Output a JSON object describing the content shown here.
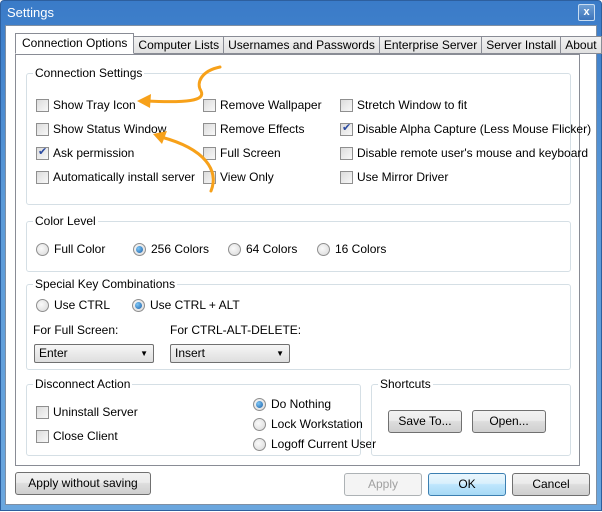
{
  "window": {
    "title": "Settings",
    "close_icon": "close-icon"
  },
  "tabs": [
    {
      "label": "Connection Options",
      "active": true
    },
    {
      "label": "Computer Lists",
      "active": false
    },
    {
      "label": "Usernames and Passwords",
      "active": false
    },
    {
      "label": "Enterprise Server",
      "active": false
    },
    {
      "label": "Server Install",
      "active": false
    },
    {
      "label": "About",
      "active": false
    }
  ],
  "connection_settings": {
    "label": "Connection Settings",
    "options": [
      {
        "label": "Show Tray Icon",
        "checked": false
      },
      {
        "label": "Show Status Window",
        "checked": false
      },
      {
        "label": "Ask permission",
        "checked": true
      },
      {
        "label": "Automatically install server",
        "checked": false
      },
      {
        "label": "Remove Wallpaper",
        "checked": false
      },
      {
        "label": "Remove Effects",
        "checked": false
      },
      {
        "label": "Full Screen",
        "checked": false
      },
      {
        "label": "View Only",
        "checked": false
      },
      {
        "label": "Stretch Window to fit",
        "checked": false
      },
      {
        "label": "Disable Alpha Capture (Less Mouse Flicker)",
        "checked": true
      },
      {
        "label": "Disable remote user's mouse and keyboard",
        "checked": false
      },
      {
        "label": "Use Mirror Driver",
        "checked": false
      }
    ]
  },
  "color_level": {
    "label": "Color Level",
    "options": [
      "Full Color",
      "256 Colors",
      "64 Colors",
      "16 Colors"
    ],
    "selected": "256 Colors"
  },
  "special_keys": {
    "label": "Special Key Combinations",
    "options": [
      "Use CTRL",
      "Use CTRL + ALT"
    ],
    "selected": "Use CTRL + ALT",
    "full_screen_label": "For Full Screen:",
    "full_screen_value": "Enter",
    "cad_label": "For CTRL-ALT-DELETE:",
    "cad_value": "Insert"
  },
  "disconnect_action": {
    "label": "Disconnect Action",
    "checkboxes": [
      {
        "label": "Uninstall Server",
        "checked": false
      },
      {
        "label": "Close Client",
        "checked": false
      }
    ],
    "options": [
      "Do Nothing",
      "Lock Workstation",
      "Logoff Current User"
    ],
    "selected": "Do Nothing"
  },
  "shortcuts": {
    "label": "Shortcuts",
    "save_to": "Save To...",
    "open": "Open..."
  },
  "footer": {
    "apply_without_saving": "Apply without saving",
    "apply": "Apply",
    "ok": "OK",
    "cancel": "Cancel"
  },
  "annotation": {
    "color": "#f7a11a"
  }
}
